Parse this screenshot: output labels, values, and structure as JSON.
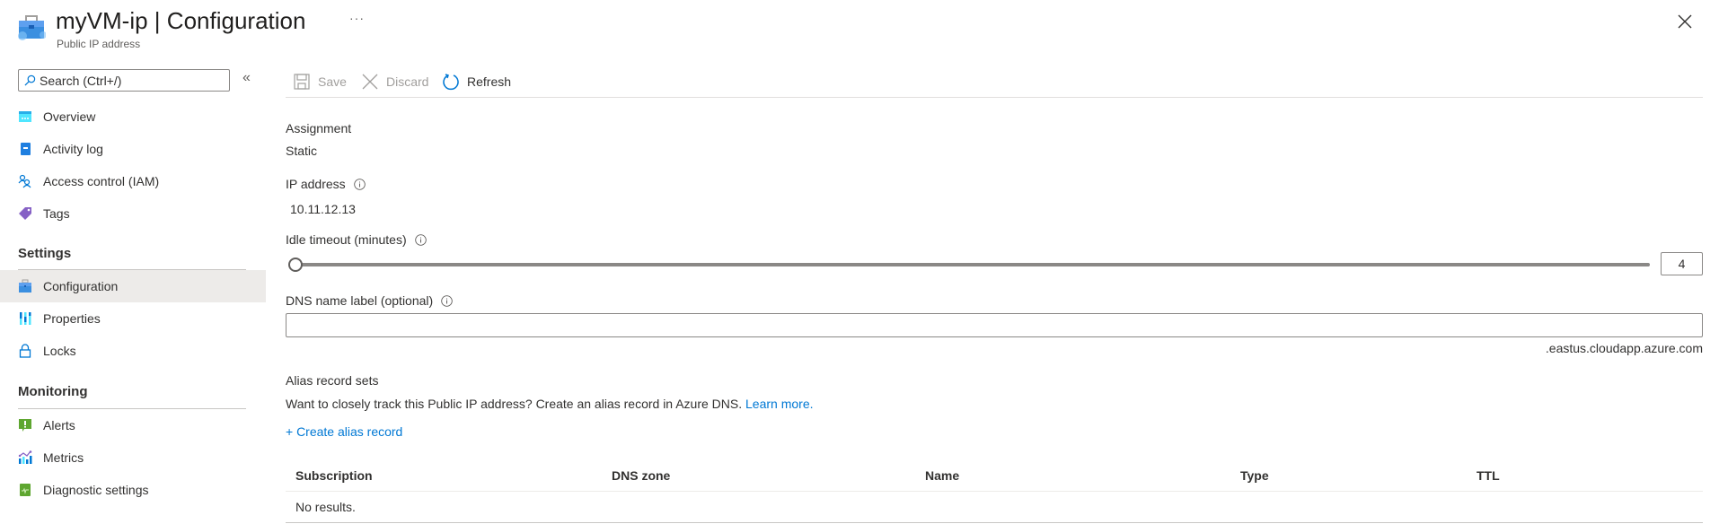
{
  "header": {
    "resource_name": "myVM-ip",
    "separator": "|",
    "blade_title": "Configuration",
    "subtitle": "Public IP address",
    "more_label": "···"
  },
  "sidebar": {
    "search_placeholder": "Search (Ctrl+/)",
    "collapse_label": "«",
    "items": [
      {
        "label": "Overview",
        "icon": "overview-icon"
      },
      {
        "label": "Activity log",
        "icon": "activity-log-icon"
      },
      {
        "label": "Access control (IAM)",
        "icon": "iam-icon"
      },
      {
        "label": "Tags",
        "icon": "tag-icon"
      }
    ],
    "groups": [
      {
        "title": "Settings",
        "items": [
          {
            "label": "Configuration",
            "icon": "configuration-icon",
            "selected": true
          },
          {
            "label": "Properties",
            "icon": "properties-icon"
          },
          {
            "label": "Locks",
            "icon": "lock-icon"
          }
        ]
      },
      {
        "title": "Monitoring",
        "items": [
          {
            "label": "Alerts",
            "icon": "alert-icon"
          },
          {
            "label": "Metrics",
            "icon": "metrics-icon"
          },
          {
            "label": "Diagnostic settings",
            "icon": "diagnostic-settings-icon"
          }
        ]
      }
    ]
  },
  "toolbar": {
    "save_label": "Save",
    "discard_label": "Discard",
    "refresh_label": "Refresh"
  },
  "form": {
    "assignment_label": "Assignment",
    "assignment_value": "Static",
    "ip_label": "IP address",
    "ip_value": "10.11.12.13",
    "idle_label": "Idle timeout (minutes)",
    "idle_value": "4",
    "idle_min": 4,
    "idle_max": 30,
    "dns_label": "DNS name label (optional)",
    "dns_value": "",
    "dns_suffix": ".eastus.cloudapp.azure.com"
  },
  "alias": {
    "title": "Alias record sets",
    "description": "Want to closely track this Public IP address? Create an alias record in Azure DNS.",
    "learn_more": "Learn more.",
    "create_label": "+ Create alias record",
    "columns": [
      "Subscription",
      "DNS zone",
      "Name",
      "Type",
      "TTL"
    ],
    "empty_text": "No results."
  },
  "colors": {
    "accent": "#0078d4",
    "selected_bg": "#edebe9"
  }
}
